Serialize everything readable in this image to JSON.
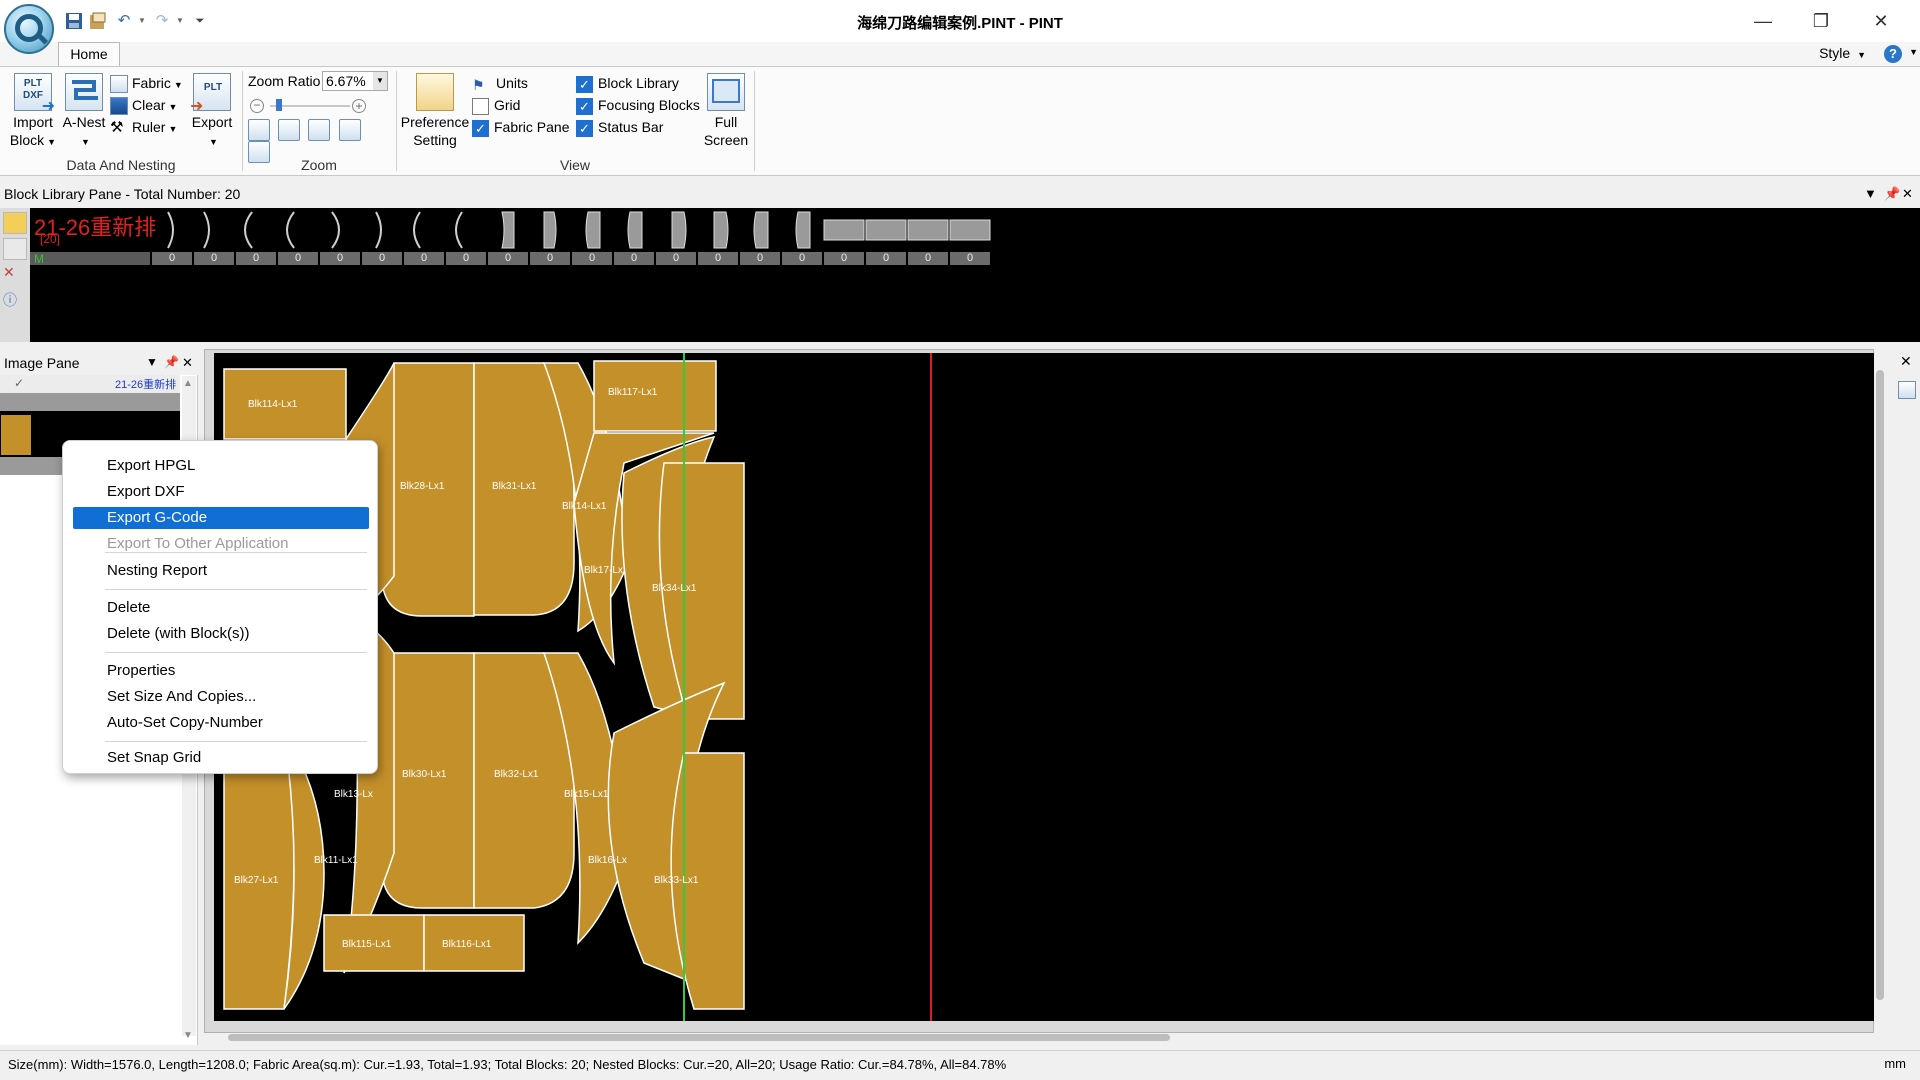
{
  "window": {
    "title": "海绵刀路编辑案例.PINT - PINT",
    "minimize": "—",
    "restore": "❐",
    "close": "✕"
  },
  "quick_access": {
    "save_icon": "save-icon",
    "save_as_icon": "save-as-icon",
    "undo_icon": "undo-icon",
    "redo_icon": "redo-icon",
    "customize_icon": "customize-icon"
  },
  "ribbon": {
    "tab_home": "Home",
    "style_label": "Style",
    "help_glyph": "?",
    "groups": {
      "data_and_nesting": "Data And Nesting",
      "zoom": "Zoom",
      "view": "View"
    },
    "import_block": {
      "line1": "Import",
      "line2": "Block",
      "icon_text": "PLT DXF"
    },
    "a_nest": {
      "label": "A-Nest"
    },
    "fabric": "Fabric",
    "clear": "Clear",
    "ruler": "Ruler",
    "export": {
      "label": "Export",
      "icon_text": "PLT"
    },
    "zoom_ratio_label": "Zoom Ratio",
    "zoom_ratio_value": "6.67%",
    "preference": {
      "line1": "Preference",
      "line2": "Setting"
    },
    "units": "Units",
    "grid": "Grid",
    "fabric_pane": "Fabric Pane",
    "block_library": "Block Library",
    "focusing_blocks": "Focusing Blocks",
    "status_bar": "Status Bar",
    "full_screen": {
      "line1": "Full",
      "line2": "Screen"
    },
    "checks": {
      "units": false,
      "grid": false,
      "fabric_pane": true,
      "block_library": true,
      "focusing_blocks": true,
      "status_bar": true
    }
  },
  "block_library": {
    "header": "Block Library Pane - Total Number: 20",
    "job_name": "21-26重新排",
    "job_count": "[20]",
    "job_size": "M",
    "counts": [
      "0",
      "0",
      "0",
      "0",
      "0",
      "0",
      "0",
      "0",
      "0",
      "0",
      "0",
      "0",
      "0",
      "0",
      "0",
      "0",
      "0",
      "0",
      "0",
      "0"
    ]
  },
  "image_pane": {
    "header": "Image Pane",
    "item_label": "21-26重新排",
    "check_glyph": "✓"
  },
  "canvas": {
    "pieces": {
      "p114": "Blk114-Lx1",
      "p117": "Blk117-Lx1",
      "p28": "Blk28-Lx1",
      "p31": "Blk31-Lx1",
      "p14": "Blk14-Lx1",
      "p17": "Blk17-Lx",
      "p34": "Blk34-Lx1",
      "p30": "Blk30-Lx1",
      "p32": "Blk32-Lx1",
      "p13": "Blk13-Lx",
      "p15": "Blk15-Lx1",
      "p11": "Blk11-Lx1",
      "p16": "Blk16-Lx",
      "p27": "Blk27-Lx1",
      "p33": "Blk33-Lx1",
      "p115": "Blk115-Lx1",
      "p116": "Blk116-Lx1"
    },
    "colors": {
      "piece": "#c4902a",
      "piece_line": "#ffffff",
      "green_line": "#2ecc40",
      "red_line": "#d42020"
    }
  },
  "context_menu": {
    "export_hpgl": "Export HPGL",
    "export_dxf": "Export DXF",
    "export_gcode": "Export G-Code",
    "export_other": "Export To Other Application",
    "nesting_report": "Nesting Report",
    "delete": "Delete",
    "delete_with_blocks": "Delete (with Block(s))",
    "properties": "Properties",
    "set_size_copies": "Set Size And Copies...",
    "auto_set_copy": "Auto-Set Copy-Number",
    "set_snap_grid": "Set Snap Grid"
  },
  "statusbar": {
    "text": "Size(mm): Width=1576.0, Length=1208.0; Fabric Area(sq.m): Cur.=1.93, Total=1.93; Total Blocks: 20; Nested Blocks: Cur.=20, All=20; Usage Ratio: Cur.=84.78%, All=84.78%",
    "unit": "mm"
  }
}
